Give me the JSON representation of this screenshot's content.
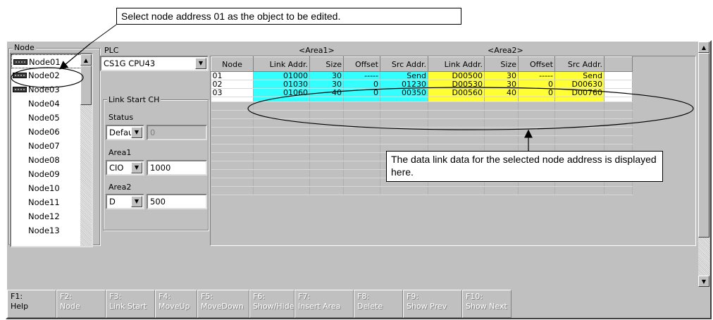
{
  "callouts": {
    "top": "Select node address 01 as the object to be edited.",
    "data_link": "The data link data for the selected node address is displayed here."
  },
  "node_panel": {
    "group_label": "Node",
    "nodes": [
      {
        "label": "Node01",
        "has_icon": true,
        "selected": true
      },
      {
        "label": "Node02",
        "has_icon": true,
        "selected": false
      },
      {
        "label": "Node03",
        "has_icon": true,
        "selected": false
      },
      {
        "label": "Node04",
        "has_icon": false,
        "selected": false
      },
      {
        "label": "Node05",
        "has_icon": false,
        "selected": false
      },
      {
        "label": "Node06",
        "has_icon": false,
        "selected": false
      },
      {
        "label": "Node07",
        "has_icon": false,
        "selected": false
      },
      {
        "label": "Node08",
        "has_icon": false,
        "selected": false
      },
      {
        "label": "Node09",
        "has_icon": false,
        "selected": false
      },
      {
        "label": "Node10",
        "has_icon": false,
        "selected": false
      },
      {
        "label": "Node11",
        "has_icon": false,
        "selected": false
      },
      {
        "label": "Node12",
        "has_icon": false,
        "selected": false
      },
      {
        "label": "Node13",
        "has_icon": false,
        "selected": false
      }
    ]
  },
  "plc_panel": {
    "plc_label": "PLC",
    "plc_value": "CS1G CPU43",
    "link_start_label": "Link Start CH",
    "status_label": "Status",
    "status_value": "Default",
    "status_number": "0",
    "area1_label": "Area1",
    "area1_type": "CIO",
    "area1_value": "1000",
    "area2_label": "Area2",
    "area2_type": "D",
    "area2_value": "500"
  },
  "grid": {
    "area1_title": "<Area1>",
    "area2_title": "<Area2>",
    "columns": [
      "Node",
      "Link Addr.",
      "Size",
      "Offset",
      "Src Addr.",
      "Link Addr.",
      "Size",
      "Offset",
      "Src Addr."
    ],
    "rows": [
      [
        "01",
        "01000",
        "30",
        "-----",
        "Send",
        "D00500",
        "30",
        "-----",
        "Send"
      ],
      [
        "02",
        "01030",
        "30",
        "0",
        "01230",
        "D00530",
        "30",
        "0",
        "D00630"
      ],
      [
        "03",
        "01060",
        "40",
        "0",
        "00350",
        "D00560",
        "40",
        "0",
        "D00760"
      ]
    ]
  },
  "function_keys": [
    {
      "key": "F1:",
      "label": "Help",
      "active": true
    },
    {
      "key": "F2:",
      "label": "Node",
      "active": false
    },
    {
      "key": "F3:",
      "label": "Link Start",
      "active": false
    },
    {
      "key": "F4:",
      "label": "MoveUp",
      "active": false
    },
    {
      "key": "F5:",
      "label": "MoveDown",
      "active": false
    },
    {
      "key": "F6:",
      "label": "Show/Hide",
      "active": false
    },
    {
      "key": "F7:",
      "label": "Insert Area",
      "active": false
    },
    {
      "key": "F8:",
      "label": "Delete",
      "active": false
    },
    {
      "key": "F9:",
      "label": "Show Prev",
      "active": false
    },
    {
      "key": "F10:",
      "label": "Show Next",
      "active": false
    }
  ],
  "colors": {
    "area1": "#33ffff",
    "area2": "#ffff33",
    "window": "#c0c0c0"
  }
}
